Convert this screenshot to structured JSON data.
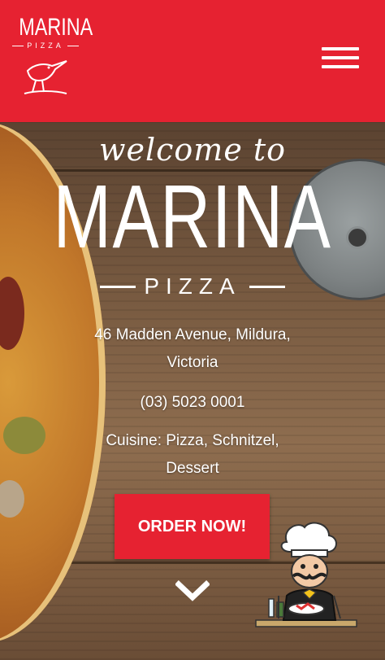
{
  "header": {
    "logo_word": "MARINA",
    "logo_sub": "PIZZA",
    "menu_icon": "hamburger-menu-icon"
  },
  "hero": {
    "welcome": "welcome to",
    "brand": "MARINA",
    "brand_sub": "PIZZA",
    "address_line1": "46 Madden Avenue, Mildura,",
    "address_line2": "Victoria",
    "phone": "(03) 5023 0001",
    "cuisine_line1": "Cuisine: Pizza, Schnitzel,",
    "cuisine_line2": "Dessert",
    "order_button": "ORDER NOW!",
    "scroll_icon": "chevron-down-icon"
  },
  "colors": {
    "brand_red": "#e62231",
    "text": "#ffffff"
  }
}
